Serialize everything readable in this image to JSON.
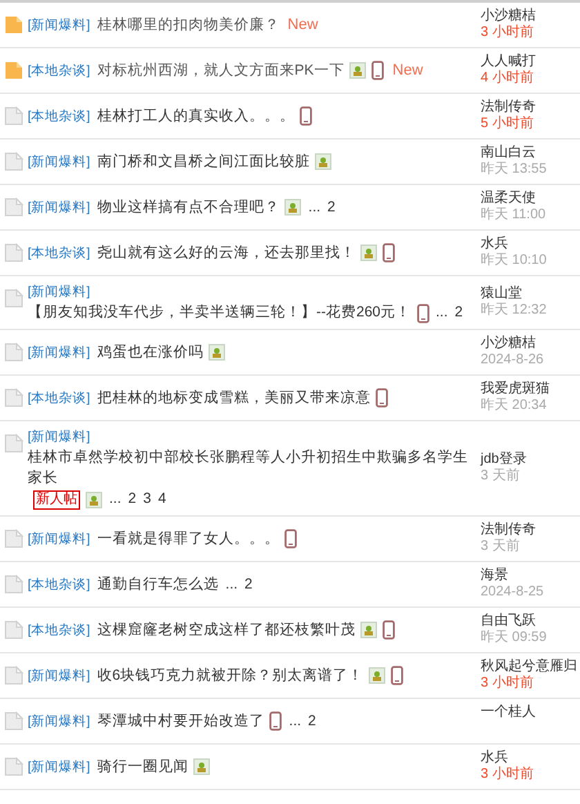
{
  "threads": [
    {
      "kind": "folder",
      "category": "[新闻爆料]",
      "title": "桂林哪里的扣肉物美价廉？",
      "image": false,
      "mobile": false,
      "new_label": "New",
      "author": "小沙糖桔",
      "time": "3 小时前",
      "recent": true
    },
    {
      "kind": "folder",
      "category": "[本地杂谈]",
      "title": "对标杭州西湖，就人文方面来PK一下",
      "image": true,
      "mobile": true,
      "new_label": "New",
      "author": "人人喊打",
      "time": "4 小时前",
      "recent": true
    },
    {
      "kind": "doc",
      "category": "[本地杂谈]",
      "title": "桂林打工人的真实收入。。。",
      "image": false,
      "mobile": true,
      "author": "法制传奇",
      "time": "5 小时前",
      "recent": true
    },
    {
      "kind": "doc",
      "category": "[新闻爆料]",
      "title": "南门桥和文昌桥之间江面比较脏",
      "image": true,
      "mobile": false,
      "author": "南山白云",
      "time": "昨天 13:55",
      "recent": false
    },
    {
      "kind": "doc",
      "category": "[新闻爆料]",
      "title": "物业这样搞有点不合理吧？",
      "image": true,
      "mobile": false,
      "pages": [
        "...",
        "2"
      ],
      "author": "温柔天使",
      "time": "昨天 11:00",
      "recent": false
    },
    {
      "kind": "doc",
      "category": "[本地杂谈]",
      "title": "尧山就有这么好的云海，还去那里找！",
      "image": true,
      "mobile": true,
      "author": "水兵",
      "time": "昨天 10:10",
      "recent": false
    },
    {
      "kind": "doc",
      "category": "[新闻爆料]",
      "title": "【朋友知我没车代步，半卖半送辆三轮！】--花费260元！",
      "image": false,
      "mobile": true,
      "pages": [
        "...",
        "2"
      ],
      "author": "猿山堂",
      "time": "昨天 12:32",
      "recent": false
    },
    {
      "kind": "doc",
      "category": "[新闻爆料]",
      "title": "鸡蛋也在涨价吗",
      "image": true,
      "mobile": false,
      "author": "小沙糖桔",
      "time": "2024-8-26",
      "recent": false
    },
    {
      "kind": "doc",
      "category": "[本地杂谈]",
      "title": "把桂林的地标变成雪糕，美丽又带来凉意",
      "image": false,
      "mobile": true,
      "author": "我爱虎斑猫",
      "time": "昨天 20:34",
      "recent": false
    },
    {
      "kind": "doc",
      "category": "[新闻爆料]",
      "title": "桂林市卓然学校初中部校长张鹏程等人小升初招生中欺骗多名学生家长",
      "newbie_label": "新人帖",
      "image": true,
      "mobile": false,
      "pages": [
        "...",
        "2",
        "3",
        "4"
      ],
      "author": "jdb登录",
      "time": "3 天前",
      "recent": false
    },
    {
      "kind": "doc",
      "category": "[新闻爆料]",
      "title": "一看就是得罪了女人。。。",
      "image": false,
      "mobile": true,
      "author": "法制传奇",
      "time": "3 天前",
      "recent": false
    },
    {
      "kind": "doc",
      "category": "[本地杂谈]",
      "title": "通勤自行车怎么选",
      "image": false,
      "mobile": false,
      "pages": [
        "...",
        "2"
      ],
      "author": "海景",
      "time": "2024-8-25",
      "recent": false
    },
    {
      "kind": "doc",
      "category": "[本地杂谈]",
      "title": "这棵窟窿老树空成这样了都还枝繁叶茂",
      "image": true,
      "mobile": true,
      "author": "自由飞跃",
      "time": "昨天 09:59",
      "recent": false
    },
    {
      "kind": "doc",
      "category": "[新闻爆料]",
      "title": "收6块钱巧克力就被开除？别太离谱了！",
      "image": true,
      "mobile": true,
      "author": "秋风起兮意雁归",
      "time": "3 小时前",
      "recent": true
    },
    {
      "kind": "doc",
      "category": "[新闻爆料]",
      "title": "琴潭城中村要开始改造了",
      "image": false,
      "mobile": true,
      "pages": [
        "...",
        "2"
      ],
      "author": "一个桂人"
    },
    {
      "kind": "doc",
      "category": "[新闻爆料]",
      "title": "骑行一圈见闻",
      "image": true,
      "mobile": false,
      "author": "水兵",
      "time": "3 小时前",
      "recent": true
    }
  ]
}
